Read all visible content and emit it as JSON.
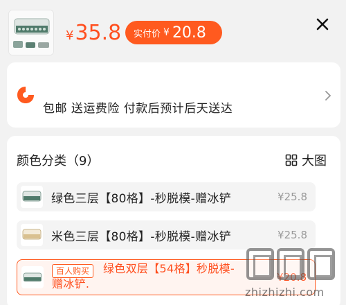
{
  "header": {
    "price_symbol": "¥",
    "price": "35.8",
    "real_price_label": "实付价",
    "real_price_symbol": "¥",
    "real_price": "20.8",
    "accent_color": "#ff5a1f"
  },
  "shipping": {
    "text": "包邮  送运费险  付款后预计后天送达"
  },
  "category": {
    "title": "颜色分类（9）",
    "big_image_label": "大图",
    "options": [
      {
        "name": "绿色三层【80格】-秒脱模-赠冰铲",
        "price": "¥25.8"
      },
      {
        "name": "米色三层【80格】-秒脱模-赠冰铲",
        "price": "¥25.8"
      },
      {
        "tag": "百人购买",
        "name_line1": "绿色双层【54格】秒脱模-",
        "name_line2": "赠冰铲.",
        "price": "¥20.8"
      }
    ]
  },
  "watermark": {
    "text": "zhizhizhi.com"
  }
}
